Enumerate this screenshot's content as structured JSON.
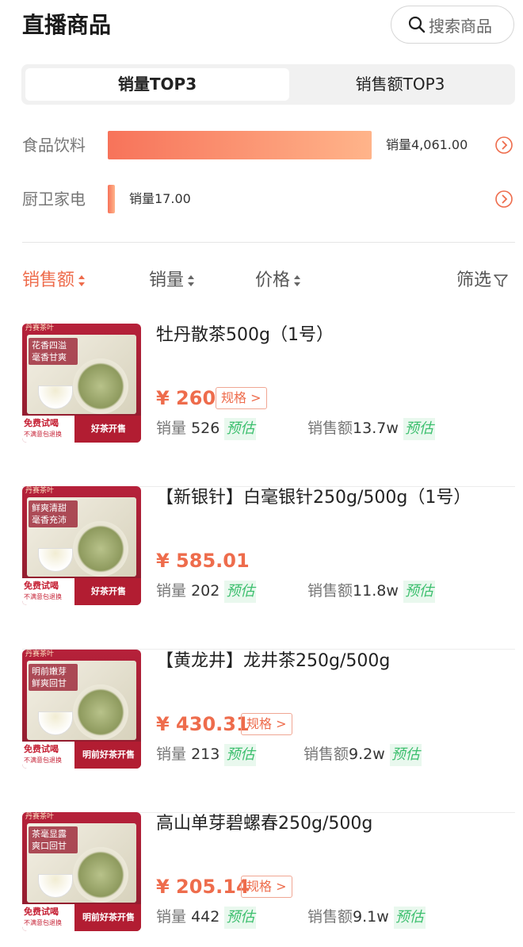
{
  "header": {
    "title": "直播商品",
    "search_label": "搜索商品"
  },
  "tabs": [
    {
      "label": "销量TOP3",
      "active": true
    },
    {
      "label": "销售额TOP3",
      "active": false
    }
  ],
  "categories": [
    {
      "name": "食品饮料",
      "value_label": "销量4,061.00",
      "sales": 4061.0
    },
    {
      "name": "厨卫家电",
      "value_label": "销量17.00",
      "sales": 17.0
    }
  ],
  "sort": {
    "items": [
      {
        "label": "销售额",
        "active": true
      },
      {
        "label": "销量",
        "active": false
      },
      {
        "label": "价格",
        "active": false
      }
    ],
    "filter_label": "筛选"
  },
  "products": [
    {
      "title": "牡丹散茶500g（1号）",
      "price": "¥ 260",
      "spec_label": "规格 >",
      "has_spec": true,
      "sales_label": "销量",
      "sales_value": "526",
      "amount_label": "销售额",
      "amount_value": "13.7w",
      "estimate_tag": "预估",
      "thumb": {
        "brand": "丹赛茶叶",
        "slogan": "花香四溢 毫香甘爽",
        "badge_main": "免费试喝",
        "badge_sub": "不满意包退换",
        "tag": "好茶开售"
      }
    },
    {
      "title": "【新银针】白毫银针250g/500g（1号）",
      "price": "¥ 585.01",
      "spec_label": "",
      "has_spec": false,
      "sales_label": "销量",
      "sales_value": "202",
      "amount_label": "销售额",
      "amount_value": "11.8w",
      "estimate_tag": "预估",
      "thumb": {
        "brand": "丹赛茶叶",
        "slogan": "鲜爽清甜 毫香充沛",
        "badge_main": "免费试喝",
        "badge_sub": "不满意包退换",
        "tag": "好茶开售"
      }
    },
    {
      "title": "【黄龙井】龙井茶250g/500g",
      "price": "¥ 430.31",
      "spec_label": "规格 >",
      "has_spec": true,
      "sales_label": "销量",
      "sales_value": "213",
      "amount_label": "销售额",
      "amount_value": "9.2w",
      "estimate_tag": "预估",
      "thumb": {
        "brand": "丹赛茶叶",
        "slogan": "明前嫩芽 鲜爽回甘",
        "badge_main": "免费试喝",
        "badge_sub": "不满意包退换",
        "tag": "明前好茶开售"
      }
    },
    {
      "title": "高山单芽碧螺春250g/500g",
      "price": "¥ 205.14",
      "spec_label": "规格 >",
      "has_spec": true,
      "sales_label": "销量",
      "sales_value": "442",
      "amount_label": "销售额",
      "amount_value": "9.1w",
      "estimate_tag": "预估",
      "thumb": {
        "brand": "丹赛茶叶",
        "slogan": "茶毫显露 爽口回甘",
        "badge_main": "免费试喝",
        "badge_sub": "不满意包退换",
        "tag": "明前好茶开售"
      }
    }
  ],
  "colors": {
    "accent": "#ee6c4c",
    "estimate_green": "#3cbf6e",
    "bar_start": "#f7735a",
    "bar_end": "#ffb48a"
  }
}
